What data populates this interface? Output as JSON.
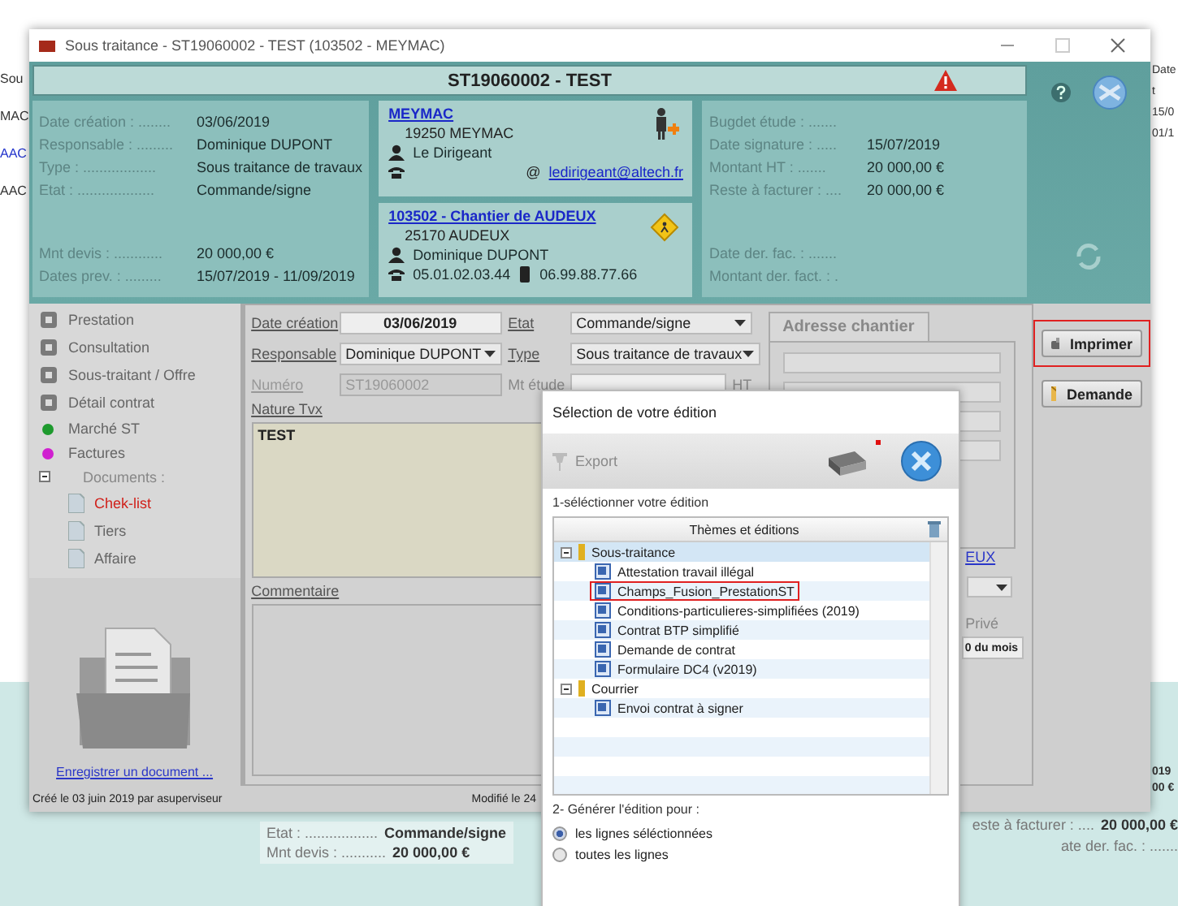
{
  "background": {
    "left_texts": [
      {
        "text": "Sou",
        "link": false
      },
      {
        "text": "MAC",
        "link": false
      },
      {
        "text": "AAC",
        "link": true
      },
      {
        "text": "AAC",
        "link": false
      }
    ],
    "right_texts": [
      "Date",
      "t",
      "15/0",
      "01/1"
    ],
    "bottom_left": [
      {
        "label": "Etat : ..................",
        "value": "Commande/signe"
      },
      {
        "label": "Mnt devis : ...........",
        "value": "20 000,00 €"
      }
    ],
    "edge_values": [
      "019",
      "00 €"
    ],
    "bottom_right": [
      {
        "label": "este à facturer : ....",
        "value": "20 000,00 €"
      },
      {
        "label": "ate der. fac. : ......."
      }
    ]
  },
  "window": {
    "title": "Sous traitance - ST19060002 - TEST (103502 - MEYMAC)"
  },
  "header": {
    "title": "ST19060002 - TEST",
    "left_top": [
      {
        "label": "Date création : ........",
        "value": "03/06/2019"
      },
      {
        "label": "Responsable : .........",
        "value": "Dominique DUPONT"
      },
      {
        "label": "Type : ..................",
        "value": "Sous traitance de travaux"
      },
      {
        "label": "Etat : ...................",
        "value": "Commande/signe"
      }
    ],
    "left_bottom": [
      {
        "label": "Mnt devis : ............",
        "value": "20 000,00 €"
      },
      {
        "label": "Dates prev. : .........",
        "value": "15/07/2019 - 11/09/2019"
      }
    ],
    "tiers": {
      "name": "MEYMAC",
      "city": "19250 MEYMAC",
      "contact": "Le Dirigeant",
      "email_symbol": "@",
      "email": "ledirigeant@altech.fr"
    },
    "chantier": {
      "name": "103502 - Chantier de AUDEUX",
      "city": "25170 AUDEUX",
      "contact": "Dominique DUPONT",
      "phone": "05.01.02.03.44",
      "mobile": "06.99.88.77.66"
    },
    "right_top": [
      {
        "label": "Bugdet étude : ......."
      },
      {
        "label": "Date signature : .....",
        "value": "15/07/2019"
      },
      {
        "label": "Montant HT : .......",
        "value": "20 000,00 €"
      },
      {
        "label": "Reste à facturer : ....",
        "value": "20 000,00 €"
      }
    ],
    "right_bottom": [
      {
        "label": "Date der. fac. : ......."
      },
      {
        "label": "Montant der. fact. : ."
      }
    ]
  },
  "sidebar": {
    "items": [
      {
        "kind": "icon",
        "label": "Prestation"
      },
      {
        "kind": "icon",
        "label": "Consultation"
      },
      {
        "kind": "icon",
        "label": "Sous-traitant / Offre"
      },
      {
        "kind": "icon",
        "label": "Détail contrat"
      },
      {
        "kind": "dot",
        "label": "Marché ST",
        "color": "#1e9a2e"
      },
      {
        "kind": "dot",
        "label": "Factures",
        "color": "#d020d0"
      },
      {
        "kind": "group",
        "label": "Documents :",
        "expanded": true,
        "children": [
          {
            "label": "Chek-list",
            "selected": true
          },
          {
            "label": "Tiers",
            "selected": false
          },
          {
            "label": "Affaire",
            "selected": false
          }
        ]
      }
    ],
    "document_link": "Enregistrer un document ..."
  },
  "form": {
    "fields": [
      {
        "kind": "input",
        "label": "Date création",
        "value": "03/06/2019",
        "disabled": false
      },
      {
        "kind": "select",
        "label": "Etat",
        "value": "Commande/signe",
        "disabled": false
      },
      {
        "kind": "select",
        "label": "Responsable",
        "value": "Dominique DUPONT",
        "disabled": false
      },
      {
        "kind": "select",
        "label": "Type",
        "value": "Sous traitance de travaux",
        "disabled": false
      },
      {
        "kind": "input",
        "label": "Numéro",
        "value": "ST19060002",
        "disabled": true
      },
      {
        "kind": "amount",
        "label": "Mt étude",
        "unit": "HT",
        "disabled": false
      }
    ],
    "nature": {
      "label": "Nature Tvx",
      "value": "TEST"
    },
    "comment": {
      "label": "Commentaire"
    },
    "tab": {
      "label": "Adresse chantier",
      "link": "EUX",
      "private_label": "Privé",
      "day_value": "0 du mois"
    }
  },
  "buttons": [
    {
      "label": "Imprimer",
      "highlighted": true
    },
    {
      "label": "Demande",
      "highlighted": false
    }
  ],
  "status_bar": {
    "created": "Créé le 03 juin 2019 par asuperviseur",
    "modified": "Modifié le 24"
  },
  "dialog": {
    "title": "Sélection de votre édition",
    "export": {
      "label": "Export",
      "disabled": true
    },
    "step1": "1-séléctionner votre édition",
    "column": "Thèmes et éditions",
    "tree": [
      {
        "label": "Sous-traitance",
        "expanded": true,
        "children": [
          {
            "label": "Attestation travail illégal",
            "highlighted": false
          },
          {
            "label": "Champs_Fusion_PrestationST",
            "highlighted": true
          },
          {
            "label": "Conditions-particulieres-simplifiées (2019)",
            "highlighted": false
          },
          {
            "label": "Contrat BTP simplifié",
            "highlighted": false
          },
          {
            "label": "Demande de contrat",
            "highlighted": false
          },
          {
            "label": "Formulaire DC4 (v2019)",
            "highlighted": false
          }
        ]
      },
      {
        "label": "Courrier",
        "expanded": true,
        "children": [
          {
            "label": "Envoi contrat à signer",
            "highlighted": false
          }
        ]
      }
    ],
    "step2": "2- Générer l'édition pour :",
    "options": [
      {
        "label": "les lignes séléctionnées",
        "selected": true
      },
      {
        "label": "toutes les lignes",
        "selected": false
      }
    ]
  }
}
